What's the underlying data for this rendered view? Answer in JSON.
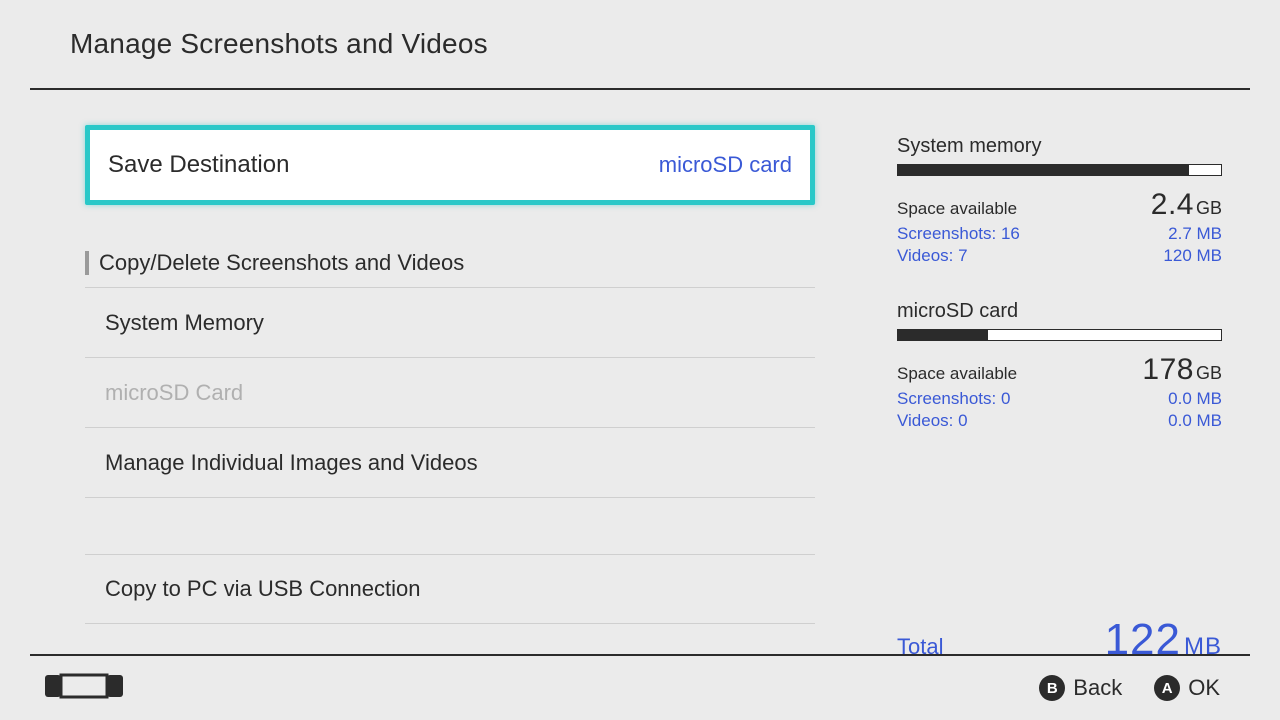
{
  "header": {
    "title": "Manage Screenshots and Videos"
  },
  "menu": {
    "save_destination": {
      "label": "Save Destination",
      "value": "microSD card"
    },
    "section_label": "Copy/Delete Screenshots and Videos",
    "items": {
      "system_memory": "System Memory",
      "microsd_card": "microSD Card",
      "manage_individual": "Manage Individual Images and Videos",
      "copy_to_pc": "Copy to PC via USB Connection"
    }
  },
  "storage": {
    "system": {
      "title": "System memory",
      "fill_pct": 90,
      "available_label": "Space available",
      "available_value": "2.4",
      "available_unit": "GB",
      "screenshots_label": "Screenshots: 16",
      "screenshots_size": "2.7 MB",
      "videos_label": "Videos: 7",
      "videos_size": "120 MB"
    },
    "microsd": {
      "title": "microSD card",
      "fill_pct": 28,
      "available_label": "Space available",
      "available_value": "178",
      "available_unit": "GB",
      "screenshots_label": "Screenshots: 0",
      "screenshots_size": "0.0 MB",
      "videos_label": "Videos: 0",
      "videos_size": "0.0 MB"
    },
    "total": {
      "label": "Total",
      "value": "122",
      "unit": "MB"
    }
  },
  "footer": {
    "back_glyph": "B",
    "back_label": "Back",
    "ok_glyph": "A",
    "ok_label": "OK"
  }
}
